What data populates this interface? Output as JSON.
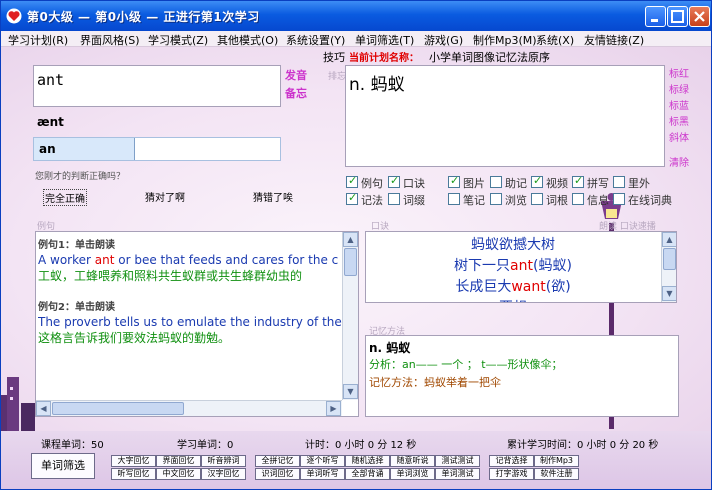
{
  "window": {
    "title": "第0大级 — 第0小级 — 正进行第1次学习"
  },
  "menu": [
    "学习计划(R)",
    "界面风格(S)",
    "学习模式(Z)",
    "其他模式(O)",
    "系统设置(Y)",
    "单词筛选(T)",
    "游戏(G)",
    "制作Mp3(M)",
    "系统(X)",
    "友情链接(Z)"
  ],
  "plan": {
    "skill_label": "技巧",
    "current_label": "当前计划名称：",
    "current_value": "小学单词图像记忆法原序"
  },
  "word": {
    "text": "ant",
    "phonetic": "ænt",
    "input_prompt": "an",
    "input_value": ""
  },
  "side_links": {
    "pronounce": "发音",
    "memo": "备忘",
    "sep": "排忘"
  },
  "judge": {
    "question": "您刚才的判断正确吗？",
    "b1": "完全正确",
    "b2": "猜对了啊",
    "b3": "猜错了唉"
  },
  "meaning": {
    "text": "n. 蚂蚁"
  },
  "right_links": [
    "标红",
    "标绿",
    "标蓝",
    "标黑",
    "斜体",
    "清除"
  ],
  "checks": [
    {
      "label": "例句",
      "on": true
    },
    {
      "label": "口诀",
      "on": true
    },
    {
      "label": "图片",
      "on": true
    },
    {
      "label": "助记",
      "on": false
    },
    {
      "label": "视频",
      "on": true
    },
    {
      "label": "拼写",
      "on": true
    },
    {
      "label": "里外",
      "on": false
    },
    {
      "label": "记法",
      "on": true
    },
    {
      "label": "词缀",
      "on": false
    },
    {
      "label": "笔记",
      "on": false
    },
    {
      "label": "浏览",
      "on": false
    },
    {
      "label": "词根",
      "on": false
    },
    {
      "label": "信息",
      "on": false
    },
    {
      "label": "在线词典",
      "on": false
    }
  ],
  "section_labels": {
    "examples": "例句",
    "mnemonic": "口诀",
    "mnemonic_right": "朗读  口诀速播",
    "method": "记忆方法"
  },
  "examples": {
    "ex1_title": "例句1：单击朗读",
    "ex1_en_pre": "A worker ",
    "ex1_en_hl": "ant",
    "ex1_en_post": " or bee that feeds and cares for the c",
    "ex1_cn": "工蚁，工蜂喂养和照料共生蚁群或共生蜂群幼虫的",
    "ex2_title": "例句2：单击朗读",
    "ex2_en": "The proverb tells us to emulate the industry of the",
    "ex2_cn": "这格言告诉我们要效法蚂蚁的勤勉。"
  },
  "mnemonic": {
    "l1": "蚂蚁欲撼大树",
    "l2_pre": "树下一只",
    "l2_hl": "ant",
    "l2_post": "(蚂蚁)",
    "l3_pre": "长成巨大",
    "l3_hl": "want",
    "l3_post": "(欲)",
    "l4": "要想"
  },
  "method": {
    "pos": "n. 蚂蚁",
    "analysis": "分析：an—— 一个 ； t——形状像伞；",
    "memory": "记忆方法：蚂蚁举着一把伞"
  },
  "stats": {
    "course": "课程单词：50",
    "learn": "学习单词：0",
    "timer": "计时：0 小时 0 分 12 秒",
    "total": "累计学习时间：0 小时 0 分 20 秒"
  },
  "filter_button": "单词筛选",
  "bottom_buttons": [
    "大字回忆",
    "界面回忆",
    "听音辨词",
    "全拼记忆",
    "逐个听写",
    "随机选择",
    "随意听说",
    "测试测试",
    "记背选择",
    "制作Mp3",
    "听写回忆",
    "中文回忆",
    "汉字回忆",
    "识词回忆",
    "单词听写",
    "全部背诵",
    "单词浏览",
    "单词测试",
    "打字游戏",
    "软件注册"
  ],
  "colors": {
    "accent": "#cc33cc",
    "red": "#e00000",
    "green": "#109010",
    "blue": "#1a3ab0",
    "brown": "#a04800"
  }
}
